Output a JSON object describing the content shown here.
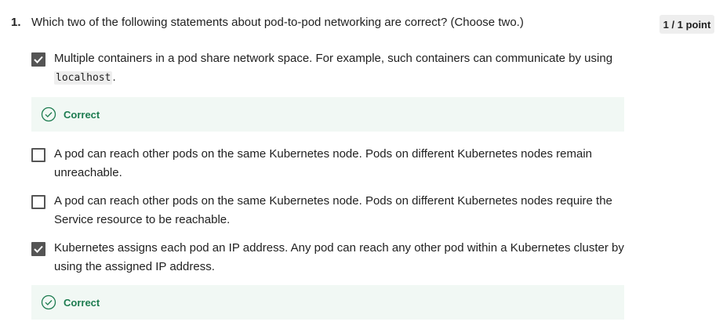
{
  "question": {
    "number": "1.",
    "text": "Which two of the following statements about pod-to-pod networking are correct? (Choose two.)",
    "score": "1 / 1 point"
  },
  "options": [
    {
      "checked": true,
      "text_before": "Multiple containers in a pod share network space. For example, such containers can communicate by using ",
      "code": "localhost",
      "text_after": ".",
      "feedback": "Correct"
    },
    {
      "checked": false,
      "text_line1": "A pod can reach other pods on the same Kubernetes node. Pods on different Kubernetes nodes remain",
      "text_line2": "unreachable."
    },
    {
      "checked": false,
      "text_line1": "A pod can reach other pods on the same Kubernetes node. Pods on different Kubernetes nodes require the",
      "text_line2": "Service resource to be reachable."
    },
    {
      "checked": true,
      "text_line1": "Kubernetes assigns each pod an IP address. Any pod can reach any other pod within a Kubernetes cluster by",
      "text_line2": "using the assigned IP address.",
      "feedback": "Correct"
    }
  ],
  "colors": {
    "correct_text": "#1d7c50",
    "feedback_bg": "#f1f8f4",
    "checkbox_checked": "#545454"
  },
  "icons": {
    "check": "checkmark-icon",
    "correct": "check-circle-icon"
  }
}
